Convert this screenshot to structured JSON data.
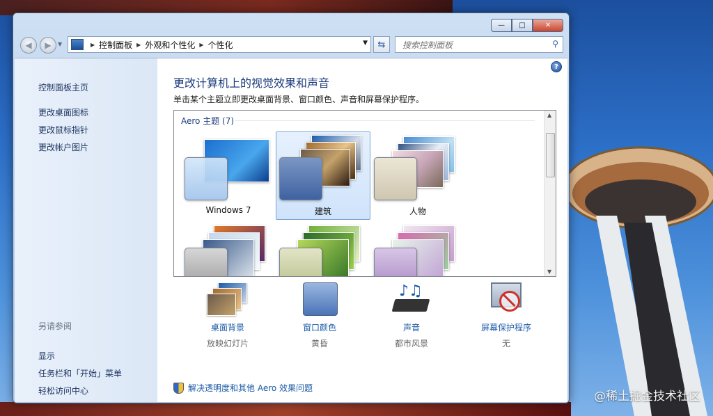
{
  "window": {
    "close_glyph": "✕",
    "min_glyph": "—",
    "max_glyph": "□"
  },
  "address": {
    "crumbs": [
      "控制面板",
      "外观和个性化",
      "个性化"
    ]
  },
  "search": {
    "placeholder": "搜索控制面板"
  },
  "sidebar": {
    "home": "控制面板主页",
    "links": [
      "更改桌面图标",
      "更改鼠标指针",
      "更改帐户图片"
    ],
    "see_also_title": "另请参阅",
    "see_also": [
      "显示",
      "任务栏和「开始」菜单",
      "轻松访问中心"
    ]
  },
  "main": {
    "title": "更改计算机上的视觉效果和声音",
    "subtitle": "单击某个主题立即更改桌面背景、窗口颜色、声音和屏幕保护程序。",
    "group_title": "Aero 主题 (7)",
    "themes": [
      {
        "label": "Windows 7",
        "selected": false
      },
      {
        "label": "建筑",
        "selected": true
      },
      {
        "label": "人物",
        "selected": false
      },
      {
        "label": "",
        "selected": false
      },
      {
        "label": "",
        "selected": false
      },
      {
        "label": "",
        "selected": false
      }
    ],
    "bottom": [
      {
        "title": "桌面背景",
        "value": "放映幻灯片"
      },
      {
        "title": "窗口颜色",
        "value": "黄昏"
      },
      {
        "title": "声音",
        "value": "都市风景"
      },
      {
        "title": "屏幕保护程序",
        "value": "无"
      }
    ],
    "troubleshoot": "解决透明度和其他 Aero 效果问题"
  },
  "desktop": {
    "watermark": "@稀土掘金技术社区"
  },
  "colors": {
    "link": "#1b5aa6",
    "heading": "#1b3a7c",
    "sidebar": "#1e3460"
  }
}
